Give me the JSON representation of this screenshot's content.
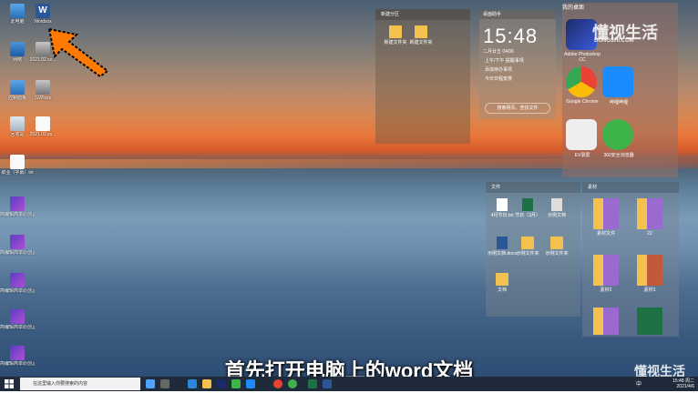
{
  "desktop": {
    "icons": [
      {
        "label": "此电脑"
      },
      {
        "label": "Wordxxx"
      },
      {
        "label": "网络"
      },
      {
        "label": "2021.02.xx..."
      },
      {
        "label": "控制面板"
      },
      {
        "label": "GVPxxx"
      },
      {
        "label": "回收站"
      },
      {
        "label": "2021.02.xx..."
      },
      {
        "label": "职业（字幕）txt"
      },
      {
        "label": "简编辑简单原创.jpg"
      },
      {
        "label": "简编辑简单原创.jpg"
      },
      {
        "label": "简编辑简单原创.jpg"
      },
      {
        "label": "简编辑简单原创.jpg"
      },
      {
        "label": "简编辑简单原创.jpg"
      },
      {
        "label": "简编辑简单原创.jpg"
      }
    ]
  },
  "panel_middle": {
    "title": "新建分区",
    "items": [
      {
        "label": "新建文件夹"
      },
      {
        "label": "新建文件夹"
      }
    ]
  },
  "clock_widget": {
    "title": "桌面助手",
    "time": "15:48",
    "date": "二月廿五 04/06",
    "rows": [
      "上午/下午 提醒事项",
      "添加待办事项",
      "今日日程安排"
    ],
    "search": "搜索网页、查找文件"
  },
  "panel_right_top": {
    "title": "我的桌面",
    "apps": [
      {
        "label": "Adobe Photoshop CC"
      },
      {
        "label": "Google Chrome"
      },
      {
        "label": "哔哩哔哩"
      },
      {
        "label": "EV录屏"
      },
      {
        "label": "360安全浏览器"
      }
    ]
  },
  "panel_files": {
    "title": "文件",
    "items": [
      {
        "label": "4月节日.txt"
      },
      {
        "label": "节日（3月）"
      },
      {
        "label": "示例文档"
      },
      {
        "label": "示例文档.docx"
      },
      {
        "label": "示例文件夹"
      },
      {
        "label": "示例文件夹"
      },
      {
        "label": "文档"
      }
    ]
  },
  "panel_work": {
    "title": "素材",
    "items": [
      {
        "label": "素材文件"
      },
      {
        "label": "22"
      },
      {
        "label": "素材2"
      },
      {
        "label": "素材3"
      },
      {
        "label": ""
      },
      {
        "label": ""
      }
    ]
  },
  "caption": "首先打开电脑上的word文档",
  "watermark": {
    "text": "懂视生活",
    "sub": "DONGSHI.COM"
  },
  "taskbar": {
    "search_placeholder": "在这里输入你要搜索的内容",
    "tray_time": "15:48 周二",
    "tray_date": "2021/4/6",
    "ime": "中"
  },
  "colors": {
    "arrow": "#ff7a00",
    "taskbar": "#1f2a3a",
    "word": "#2b5797"
  }
}
